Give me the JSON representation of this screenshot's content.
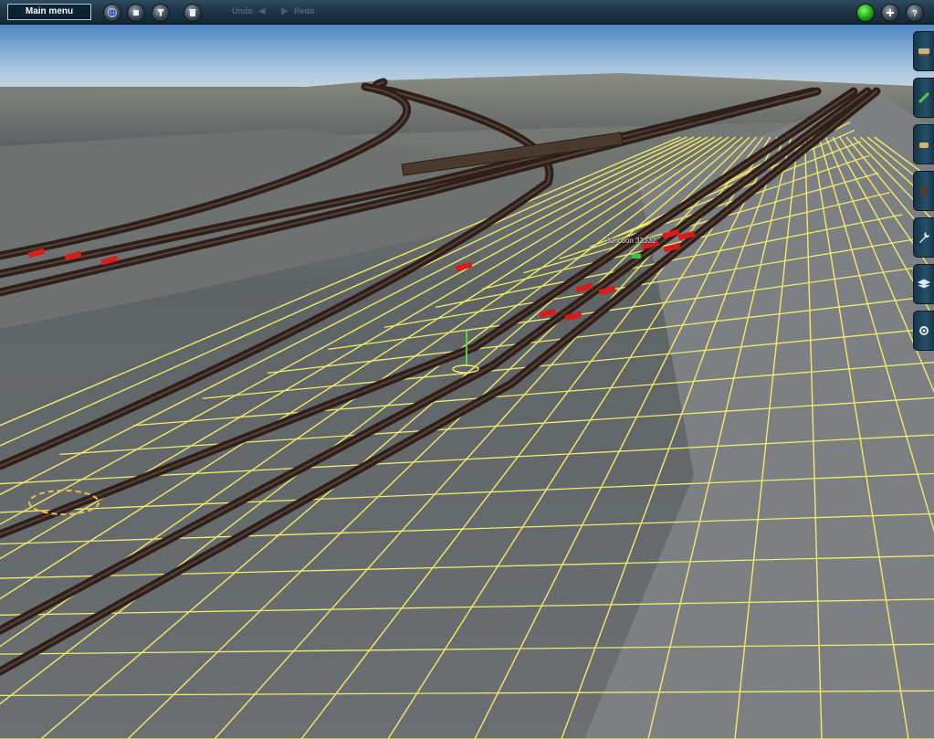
{
  "toolbar": {
    "main_menu_label": "Main menu",
    "undo_label": "Undo",
    "redo_label": "Redo",
    "left_icons": [
      "globe-icon",
      "layer-icon",
      "filter-icon",
      "trash-icon"
    ],
    "right_icons": [
      "status-green-light-icon",
      "add-icon",
      "help-icon"
    ]
  },
  "side_tools": [
    "train-tool-icon",
    "track-tool-icon",
    "object-tool-icon",
    "paint-tool-icon",
    "wrench-icon",
    "layers-tool-icon",
    "settings-tool-icon"
  ],
  "scene": {
    "junction_label": "Junction 32332"
  },
  "colors": {
    "grid": "#f2ea6a",
    "sky_top": "#5a8cc4",
    "toolbar": "#1b3344",
    "track": "#2d1f1a"
  }
}
